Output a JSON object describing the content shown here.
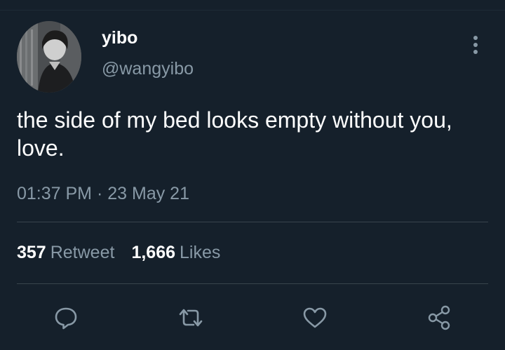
{
  "author": {
    "display_name": "yibo",
    "handle": "@wangyibo",
    "avatar_icon": "profile-photo"
  },
  "tweet": {
    "text": "the side of my bed looks empty without you, love.",
    "time": "01:37 PM",
    "separator": "·",
    "date": "23 May 21"
  },
  "stats": {
    "retweets_count": "357",
    "retweets_label": "Retweet",
    "likes_count": "1,666",
    "likes_label": "Likes"
  },
  "actions": {
    "reply_icon": "reply-icon",
    "retweet_icon": "retweet-icon",
    "like_icon": "heart-icon",
    "share_icon": "share-icon"
  },
  "theme": {
    "background": "#15202b",
    "primary_text": "#ffffff",
    "secondary_text": "#8899a6",
    "divider": "#38444d"
  }
}
